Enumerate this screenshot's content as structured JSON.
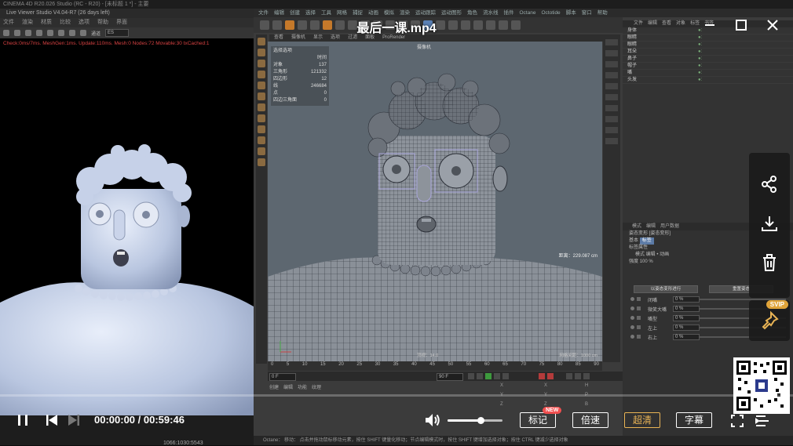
{
  "player": {
    "title": "最后一课.mp4",
    "current_time": "00:00:00",
    "duration": "00:59:46",
    "time_separator": " / ",
    "progress": 0.0,
    "volume": 0.6,
    "buttons": {
      "mark": "标记",
      "mark_badge": "NEW",
      "speed": "倍速",
      "quality": "超清",
      "subtitle": "字幕"
    },
    "svip_badge": "SVIP",
    "accent_color": "#4ea6ff",
    "highlight_color": "#e9b455"
  },
  "live_viewer": {
    "window_title": "Live Viewer Studio V4.04-R7 (26 days left)",
    "menu": [
      "文件",
      "渲染",
      "材质",
      "比较",
      "选项",
      "帮助",
      "界面"
    ],
    "select_label": "通道",
    "select_value": "ES",
    "status_text": "Check:0ms/7ms. MeshGen:1ms. Update:110ms. Mesh:0 Nodes:72 Movable:30 txCached:1",
    "bottom_label": "1066:1030:5543"
  },
  "c4d": {
    "title_bar": "CINEMA 4D R20.026 Studio (RC - R20) - [未标题 1 *] - 主要",
    "menu": [
      "文件",
      "编辑",
      "创建",
      "选择",
      "工具",
      "网格",
      "捕捉",
      "动画",
      "模拟",
      "渲染",
      "运动跟踪",
      "运动图形",
      "角色",
      "流水线",
      "插件",
      "Octane",
      "Octotide",
      "脚本",
      "窗口",
      "帮助"
    ],
    "viewport_menu": [
      "查看",
      "摄像机",
      "显示",
      "选项",
      "过滤",
      "面板",
      "ProRender"
    ],
    "camera_label": "摄像机",
    "stats": [
      {
        "label": "选择选项",
        "value": ""
      },
      {
        "label": "",
        "value": "时间"
      },
      {
        "label": "对象",
        "value": "137"
      },
      {
        "label": "三角形",
        "value": "121332"
      },
      {
        "label": "四边形",
        "value": "12"
      },
      {
        "label": "线",
        "value": "246684"
      },
      {
        "label": "点",
        "value": "0"
      },
      {
        "label": "四边三角面",
        "value": "0"
      }
    ],
    "distance_label": "距离：229.087 cm",
    "grid_label": "网格间距：1000 cm",
    "view_label": "顶视：14.0",
    "timeline_ticks": [
      "0",
      "5",
      "10",
      "15",
      "20",
      "25",
      "30",
      "35",
      "40",
      "45",
      "50",
      "55",
      "60",
      "65",
      "70",
      "75",
      "80",
      "85",
      "90"
    ],
    "frame_start": "0 F",
    "frame_field": "90 F",
    "material_tabs": [
      "创建",
      "编辑",
      "功能",
      "纹理"
    ],
    "status_bar": "Octane：  移动：  点击并拖动鼠标移动元素，按住 SHIFT 键量化移动；节点编辑模式时，按住 SHIFT 键增加选择对象；按住 CTRL 键减少选择对象",
    "object_manager": {
      "menu": [
        "文件",
        "编辑",
        "查看",
        "对象",
        "标签",
        "书签"
      ],
      "objects": [
        "身体",
        "眼睛",
        "眼睛",
        "耳朵",
        "鼻子",
        "帽子",
        "嘴",
        "头发"
      ]
    },
    "attribute_manager": {
      "menu": [
        "模式",
        "编辑",
        "用户数据"
      ],
      "object_label": "姿态变形 [姿态变形]",
      "tabs": [
        "基本",
        "标签"
      ],
      "section": "标签属性",
      "mode_row": "模式  编辑 • 动画",
      "strength_label": "强度",
      "strength_value": "100 %",
      "button_a": "以姿态变形进行",
      "button_b": "重置姿态",
      "sliders": [
        {
          "label": "闭嘴",
          "value": "0 %"
        },
        {
          "label": "微笑大嘴",
          "value": "0 %"
        },
        {
          "label": "嘴型",
          "value": "0 %"
        },
        {
          "label": "左上",
          "value": "0 %"
        },
        {
          "label": "右上",
          "value": "0 %"
        }
      ]
    }
  }
}
